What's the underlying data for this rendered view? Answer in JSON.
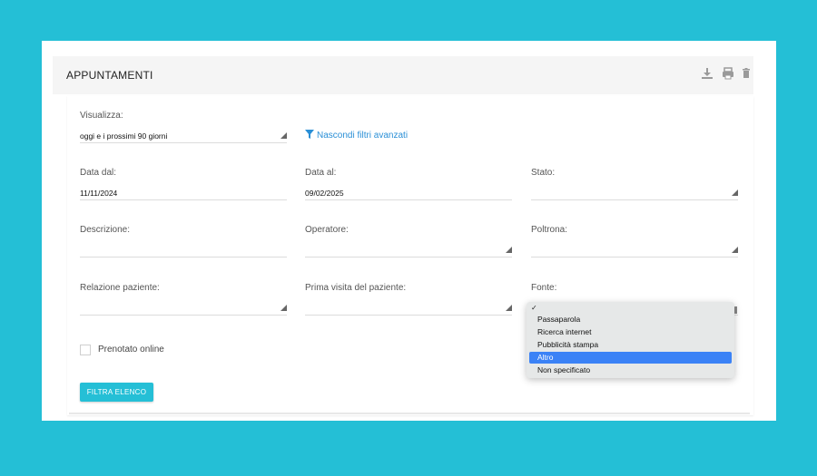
{
  "panel": {
    "title": "APPUNTAMENTI",
    "icons": [
      "download-icon",
      "print-icon",
      "trash-icon"
    ]
  },
  "filters": {
    "visualizza": {
      "label": "Visualizza:",
      "value": "oggi e i prossimi 90 giorni"
    },
    "advanced_link": "Nascondi filtri avanzati",
    "data_dal": {
      "label": "Data dal:",
      "value": "11/11/2024"
    },
    "data_al": {
      "label": "Data al:",
      "value": "09/02/2025"
    },
    "stato": {
      "label": "Stato:",
      "value": ""
    },
    "descrizione": {
      "label": "Descrizione:",
      "value": ""
    },
    "operatore": {
      "label": "Operatore:",
      "value": ""
    },
    "poltrona": {
      "label": "Poltrona:",
      "value": ""
    },
    "relazione_paziente": {
      "label": "Relazione paziente:",
      "value": ""
    },
    "prima_visita": {
      "label": "Prima visita del paziente:",
      "value": ""
    },
    "fonte": {
      "label": "Fonte:",
      "value": ""
    },
    "prenotato_online": {
      "label": "Prenotato online",
      "checked": false
    },
    "filter_button": "FILTRA ELENCO"
  },
  "fonte_dropdown": {
    "check_mark": "✓",
    "options": [
      "Passaparola",
      "Ricerca internet",
      "Pubblicità stampa",
      "Altro",
      "Non specificato"
    ],
    "highlighted": "Altro"
  },
  "colors": {
    "background": "#24bfd6",
    "accent": "#25bfd6",
    "link": "#2a8fd6",
    "highlight": "#3b82f6"
  }
}
